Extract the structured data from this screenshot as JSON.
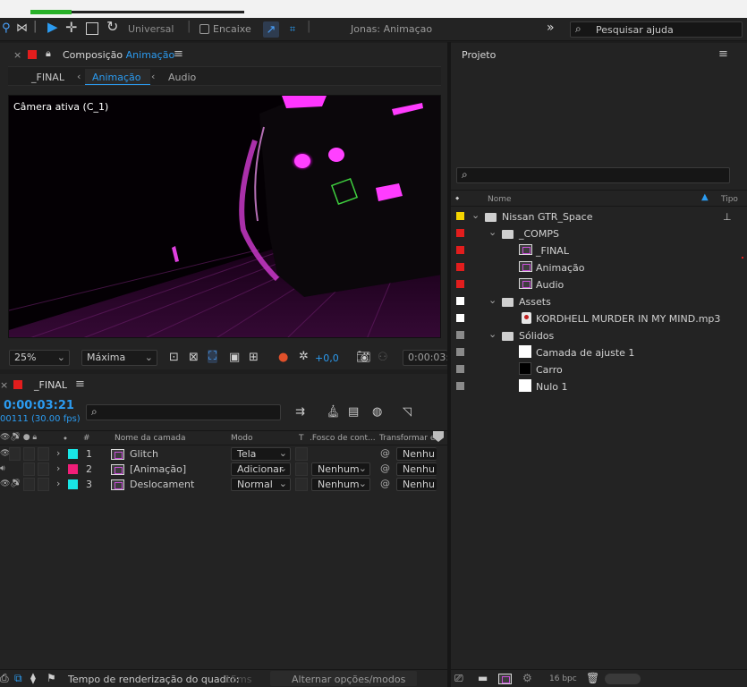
{
  "toolbar": {
    "workspace_label": "Universal",
    "snap_label": "Encaixe",
    "workspace_name": "Jonas: Animaçao",
    "expand_glyph": "»",
    "search_placeholder": "Pesquisar ajuda"
  },
  "comp_panel": {
    "title_prefix": "Composição",
    "title_name": "Animação",
    "breadcrumb": [
      "_FINAL",
      "Animação",
      "Audio"
    ],
    "camera_label": "Câmera ativa (C_1)",
    "zoom_value": "25%",
    "resolution_value": "Máxima",
    "exposure_value": "+0,0",
    "timecode_value": "0:00:03:"
  },
  "timeline_panel": {
    "tab_name": "_FINAL",
    "current_time": "0:00:03:21",
    "frame_info": "00111 (30.00 fps)",
    "search_placeholder": "",
    "columns": {
      "number": "#",
      "layer_name": "Nome da camada",
      "mode": "Modo",
      "t": "T",
      "track_matte": ".Fosco de cont...",
      "parent": "Transformar e"
    },
    "layers": [
      {
        "num": "1",
        "name": "Glitch",
        "color": "#19e6e6",
        "mode": "Tela",
        "matte": "",
        "parent": "Nenhu"
      },
      {
        "num": "2",
        "name": "[Animação]",
        "color": "#f01e78",
        "mode": "Adicionar",
        "matte": "Nenhum",
        "parent": "Nenhu"
      },
      {
        "num": "3",
        "name": "Deslocament",
        "color": "#19e6e6",
        "mode": "Normal",
        "matte": "Nenhum",
        "parent": "Nenhu"
      }
    ],
    "footer_render_label": "Tempo de renderização do quadro:",
    "footer_render_value": "15ms",
    "footer_toggle": "Alternar opções/modos"
  },
  "project_panel": {
    "title": "Projeto",
    "search_placeholder": "",
    "col_name": "Nome",
    "col_type": "Tipo",
    "items": [
      {
        "name": "Nissan GTR_Space",
        "kind": "folder",
        "label_color": "#f5d400",
        "expanded": true
      },
      {
        "name": "_COMPS",
        "kind": "folder",
        "label_color": "#e21d1d",
        "expanded": true
      },
      {
        "name": "_FINAL",
        "kind": "comp",
        "label_color": "#e21d1d"
      },
      {
        "name": "Animação",
        "kind": "comp",
        "label_color": "#e21d1d"
      },
      {
        "name": "Audio",
        "kind": "comp",
        "label_color": "#e21d1d"
      },
      {
        "name": "Assets",
        "kind": "folder",
        "label_color": "#ffffff",
        "expanded": true
      },
      {
        "name": "KORDHELL   MURDER IN MY MIND.mp3",
        "kind": "audio",
        "label_color": "#ffffff"
      },
      {
        "name": "Sólidos",
        "kind": "folder",
        "label_color": "#8a8a8a",
        "expanded": true
      },
      {
        "name": "Camada de ajuste 1",
        "kind": "solid-white",
        "label_color": "#8a8a8a"
      },
      {
        "name": "Carro",
        "kind": "solid-black",
        "label_color": "#8a8a8a"
      },
      {
        "name": "Nulo 1",
        "kind": "solid-white",
        "label_color": "#8a8a8a"
      }
    ],
    "bpc_label": "16 bpc"
  }
}
